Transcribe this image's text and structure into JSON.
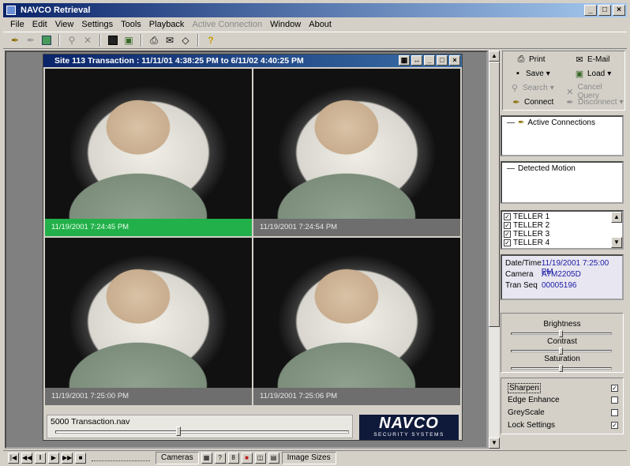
{
  "app": {
    "title": "NAVCO Retrieval"
  },
  "menu": [
    "File",
    "Edit",
    "View",
    "Settings",
    "Tools",
    "Playback",
    "Active Connection",
    "Window",
    "About"
  ],
  "menu_disabled": [
    "Active Connection"
  ],
  "child_window": {
    "title": "Site 113 Transaction : 11/11/01 4:38:25 PM to 6/11/02 4:40:25 PM"
  },
  "cameras": [
    {
      "timestamp": "11/19/2001 7:24:45 PM",
      "active": true
    },
    {
      "timestamp": "11/19/2001 7:24:54 PM",
      "active": false
    },
    {
      "timestamp": "11/19/2001 7:25:00 PM",
      "active": false
    },
    {
      "timestamp": "11/19/2001 7:25:06 PM",
      "active": false
    }
  ],
  "navigation": {
    "file": "5000 Transaction.nav",
    "progress_fraction": 0.42
  },
  "logo": {
    "name": "NAVCO",
    "tagline": "SECURITY SYSTEMS"
  },
  "actions": {
    "print": "Print",
    "email": "E-Mail",
    "save": "Save",
    "load": "Load",
    "search": "Search",
    "cancel_query": "Cancel Query",
    "connect": "Connect",
    "disconnect": "Disconnect"
  },
  "active_connections": {
    "title": "Active Connections"
  },
  "detected_motion": {
    "title": "Detected Motion"
  },
  "tellers": [
    "TELLER 1",
    "TELLER 2",
    "TELLER 3",
    "TELLER 4"
  ],
  "details": {
    "datetime_label": "Date/Time",
    "datetime": "11/19/2001 7:25:00 PM",
    "camera_label": "Camera",
    "camera": "ATM2205D",
    "transeq_label": "Tran Seq",
    "transeq": "00005196"
  },
  "adjustments": {
    "brightness_label": "Brightness",
    "brightness": 0.5,
    "contrast_label": "Contrast",
    "contrast": 0.5,
    "saturation_label": "Saturation",
    "saturation": 0.5
  },
  "options": [
    {
      "label": "Sharpen",
      "checked": true
    },
    {
      "label": "Edge Enhance",
      "checked": false
    },
    {
      "label": "GreyScale",
      "checked": false
    },
    {
      "label": "Lock Settings",
      "checked": true
    }
  ],
  "statusbar": {
    "cameras": "Cameras",
    "image_sizes": "Image Sizes"
  }
}
